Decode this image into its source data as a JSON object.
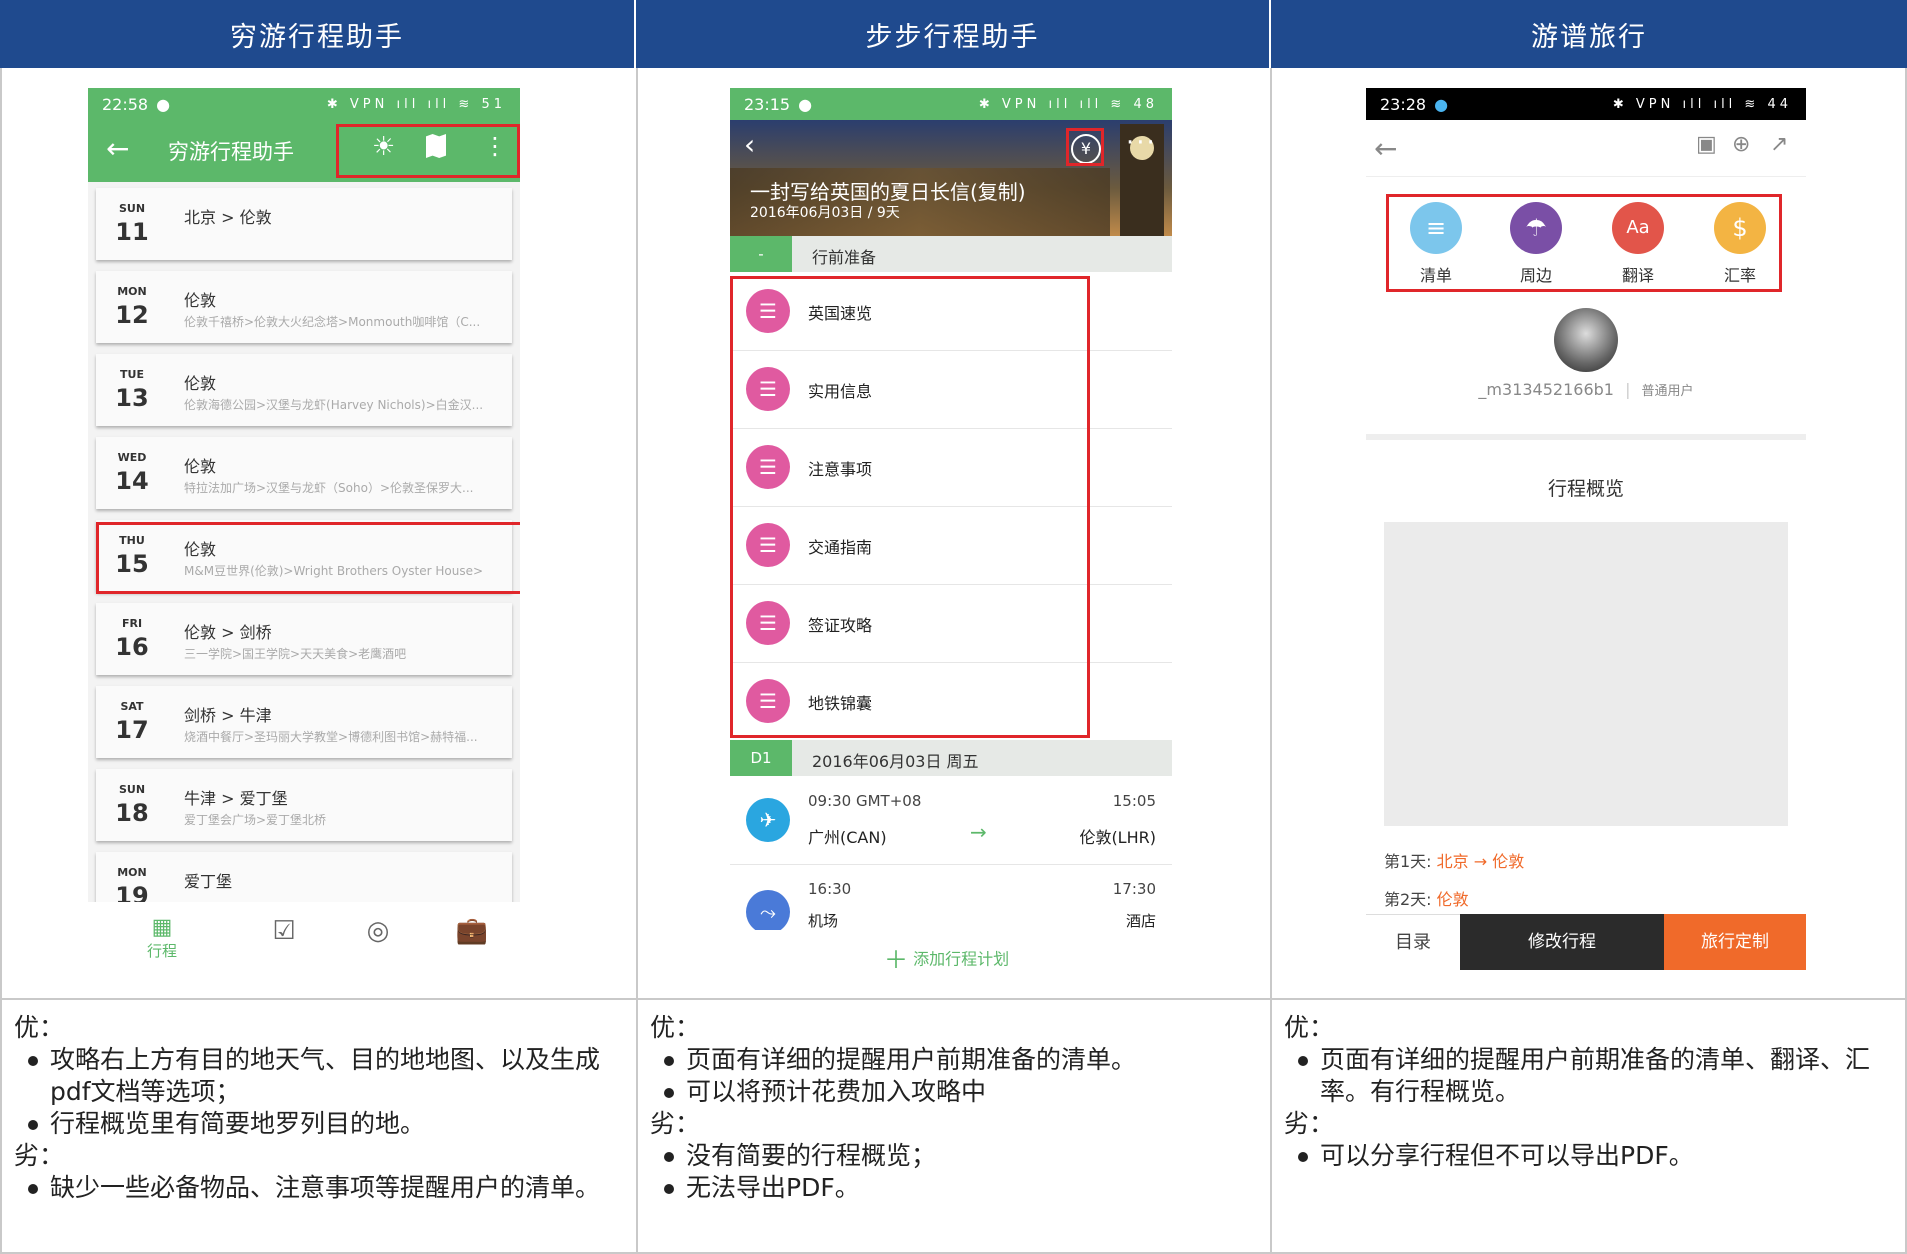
{
  "columns": [
    {
      "title": "穷游行程助手"
    },
    {
      "title": "步步行程助手"
    },
    {
      "title": "游谱旅行"
    }
  ],
  "phone1": {
    "status_time": "22:58",
    "status_right": "✱ VPN ıll ıll ≋ 51",
    "app_title": "穷游行程助手",
    "days": [
      {
        "wd": "SUN",
        "dn": "11",
        "title": "北京 > 伦敦",
        "sub": ""
      },
      {
        "wd": "MON",
        "dn": "12",
        "title": "伦敦",
        "sub": "伦敦千禧桥>伦敦大火纪念塔>Monmouth咖啡馆（C..."
      },
      {
        "wd": "TUE",
        "dn": "13",
        "title": "伦敦",
        "sub": "伦敦海德公园>汉堡与龙虾(Harvey Nichols)>白金汉..."
      },
      {
        "wd": "WED",
        "dn": "14",
        "title": "伦敦",
        "sub": "特拉法加广场>汉堡与龙虾（Soho）>伦敦圣保罗大..."
      },
      {
        "wd": "THU",
        "dn": "15",
        "title": "伦敦",
        "sub": "M&M豆世界(伦敦)>Wright Brothers Oyster House>..."
      },
      {
        "wd": "FRI",
        "dn": "16",
        "title": "伦敦 > 剑桥",
        "sub": "三一学院>国王学院>天天美食>老鹰酒吧"
      },
      {
        "wd": "SAT",
        "dn": "17",
        "title": "剑桥 > 牛津",
        "sub": "烧酒中餐厅>圣玛丽大学教堂>博德利图书馆>赫特福..."
      },
      {
        "wd": "SUN",
        "dn": "18",
        "title": "牛津 > 爱丁堡",
        "sub": "爱丁堡会广场>爱丁堡北桥"
      },
      {
        "wd": "MON",
        "dn": "19",
        "title": "爱丁堡",
        "sub": ""
      }
    ],
    "nav_label": "行程"
  },
  "phone2": {
    "status_time": "23:15",
    "status_right": "✱ VPN ıll ıll ≋ 48",
    "banner_title": "一封写给英国的夏日长信(复制)",
    "banner_sub": "2016年06月03日 / 9天",
    "prep_tag": "-",
    "prep_title": "行前准备",
    "prep_items": [
      "英国速览",
      "实用信息",
      "注意事项",
      "交通指南",
      "签证攻略",
      "地铁锦囊"
    ],
    "day_tag": "D1",
    "day_title": "2016年06月03日 周五",
    "flight": {
      "time": "09:30 GMT+08",
      "end_time": "15:05",
      "from": "广州(CAN)",
      "to": "伦敦(LHR)"
    },
    "transfer": {
      "time": "16:30",
      "end_time": "17:30",
      "from": "机场",
      "to": "酒店"
    },
    "add_label": "添加行程计划"
  },
  "phone3": {
    "status_time": "23:28",
    "status_right": "✱ VPN ıll ıll ≋ 44",
    "tools": [
      {
        "label": "清单",
        "color": "#7cc6ec",
        "icon": "📄"
      },
      {
        "label": "周边",
        "color": "#7a4fa6",
        "icon": "🏝"
      },
      {
        "label": "翻译",
        "color": "#e2554a",
        "icon": "Aa"
      },
      {
        "label": "汇率",
        "color": "#f3b443",
        "icon": "$"
      }
    ],
    "username": "_m313452166b1",
    "user_role": "普通用户",
    "overview_title": "行程概览",
    "day1_label": "第1天:",
    "day1_route": "北京 → 伦敦",
    "day2_label": "第2天:",
    "day2_route": "伦敦",
    "btn_menu": "目录",
    "btn_edit": "修改行程",
    "btn_custom": "旅行定制"
  },
  "notes": [
    {
      "pro_head": "优：",
      "pros": [
        "攻略右上方有目的地天气、目的地地图、以及生成pdf文档等选项；",
        "行程概览里有简要地罗列目的地。"
      ],
      "con_head": "劣：",
      "cons": [
        "缺少一些必备物品、注意事项等提醒用户的清单。"
      ]
    },
    {
      "pro_head": "优：",
      "pros": [
        "页面有详细的提醒用户前期准备的清单。",
        "可以将预计花费加入攻略中"
      ],
      "con_head": "劣：",
      "cons": [
        "没有简要的行程概览；",
        "无法导出PDF。"
      ]
    },
    {
      "pro_head": "优：",
      "pros": [
        "页面有详细的提醒用户前期准备的清单、翻译、汇率。有行程概览。"
      ],
      "con_head": "劣：",
      "cons": [
        "可以分享行程但不可以导出PDF。"
      ]
    }
  ]
}
